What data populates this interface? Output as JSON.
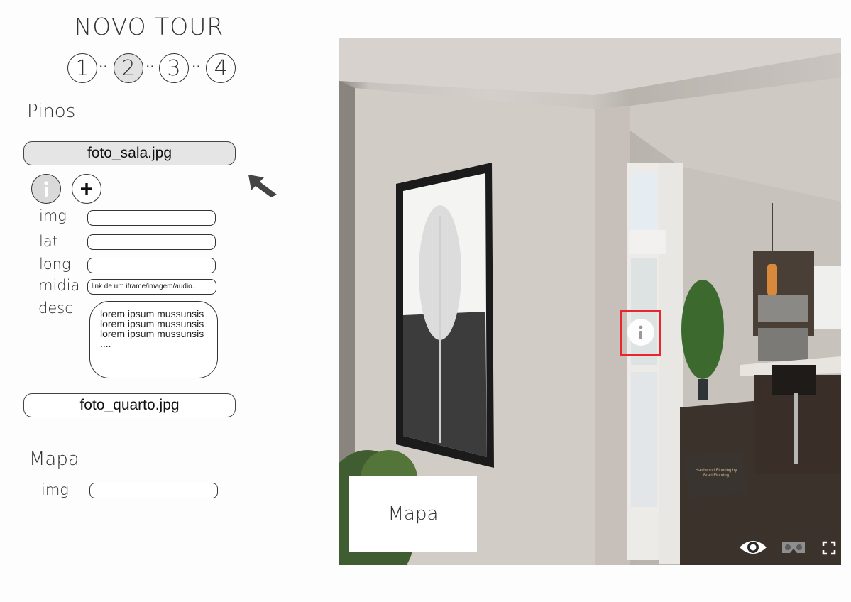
{
  "header": {
    "title": "NOVO TOUR"
  },
  "steps": {
    "items": [
      "1",
      "2",
      "3",
      "4"
    ],
    "active_index": 1,
    "separator": "··"
  },
  "pins": {
    "section_label": "Pinos",
    "files": [
      {
        "name": "foto_sala.jpg",
        "selected": true
      },
      {
        "name": "foto_quarto.jpg",
        "selected": false
      }
    ],
    "info_icon": "info-icon",
    "add_icon": "plus-icon",
    "fields": {
      "img": {
        "label": "img",
        "value": ""
      },
      "lat": {
        "label": "lat",
        "value": ""
      },
      "long": {
        "label": "long",
        "value": ""
      },
      "midia": {
        "label": "midia",
        "value": "link de um iframe/imagem/audio..."
      },
      "desc": {
        "label": "desc",
        "lines": [
          "lorem ipsum mussunsis",
          "lorem ipsum mussunsis",
          "lorem ipsum mussunsis",
          "...."
        ]
      }
    }
  },
  "map_section": {
    "label": "Mapa",
    "img_label": "img",
    "img_value": ""
  },
  "viewer": {
    "map_overlay": "Mapa",
    "hotspot_icon": "info-icon",
    "hotspot_highlight_color": "#e8262d",
    "doormat_text": [
      "Hardwood Flooring by",
      "Bred Flooring"
    ],
    "controls": [
      "eye-icon",
      "vr-headset-icon",
      "fullscreen-icon"
    ]
  },
  "pointer_icon": "arrow-cursor-icon"
}
